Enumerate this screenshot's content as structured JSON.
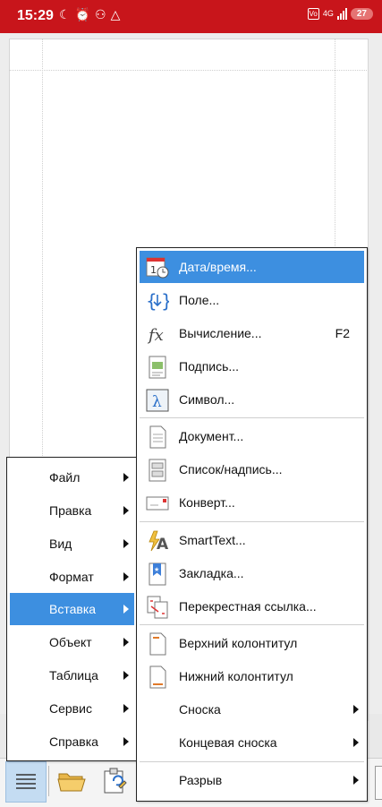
{
  "status_bar": {
    "time": "15:29",
    "left_icons": [
      "moon-icon",
      "alarm-icon",
      "share-icon",
      "drive-icon"
    ],
    "volte": "Vo",
    "network": "4G",
    "battery": "27"
  },
  "main_menu": {
    "items": [
      {
        "label": "Файл",
        "has_submenu": true
      },
      {
        "label": "Правка",
        "has_submenu": true
      },
      {
        "label": "Вид",
        "has_submenu": true
      },
      {
        "label": "Формат",
        "has_submenu": true
      },
      {
        "label": "Вставка",
        "has_submenu": true,
        "active": true
      },
      {
        "label": "Объект",
        "has_submenu": true
      },
      {
        "label": "Таблица",
        "has_submenu": true
      },
      {
        "label": "Сервис",
        "has_submenu": true
      },
      {
        "label": "Справка",
        "has_submenu": true
      }
    ]
  },
  "insert_menu": {
    "items": [
      {
        "label": "Дата/время...",
        "icon": "calendar-clock-icon",
        "active": true
      },
      {
        "label": "Поле...",
        "icon": "field-braces-icon"
      },
      {
        "label": "Вычисление...",
        "icon": "function-icon",
        "shortcut": "F2"
      },
      {
        "label": "Подпись...",
        "icon": "caption-icon"
      },
      {
        "label": "Символ...",
        "icon": "lambda-symbol-icon"
      },
      {
        "label": "Документ...",
        "icon": "document-icon"
      },
      {
        "label": "Список/надпись...",
        "icon": "list-box-icon"
      },
      {
        "label": "Конверт...",
        "icon": "envelope-icon"
      },
      {
        "label": "SmartText...",
        "icon": "smarttext-icon"
      },
      {
        "label": "Закладка...",
        "icon": "bookmark-icon"
      },
      {
        "label": "Перекрестная ссылка...",
        "icon": "cross-reference-icon"
      },
      {
        "label": "Верхний колонтитул",
        "icon": "header-icon"
      },
      {
        "label": "Нижний колонтитул",
        "icon": "footer-icon"
      },
      {
        "label": "Сноска",
        "has_submenu": true
      },
      {
        "label": "Концевая сноска",
        "has_submenu": true
      },
      {
        "label": "Разрыв",
        "has_submenu": true
      }
    ]
  },
  "toolbar": {
    "buttons": [
      "menu-icon",
      "open-folder-icon",
      "clipboard-icon"
    ]
  },
  "colors": {
    "status_bar": "#c8151b",
    "highlight": "#3d8fe0"
  }
}
